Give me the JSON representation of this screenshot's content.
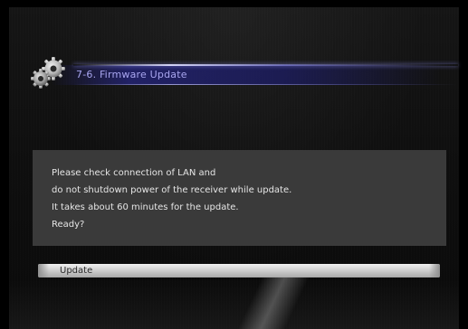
{
  "header": {
    "title": "7-6. Firmware Update",
    "icon": "gears-icon",
    "title_color": "#a9a6f0",
    "bar_color": "#23237a"
  },
  "message": {
    "lines": [
      "Please check connection of LAN and",
      "do not shutdown power of the receiver while update.",
      "It takes about 60 minutes for the update.",
      "Ready?"
    ],
    "box_color": "#3a3a3a"
  },
  "actions": {
    "update_label": "Update"
  }
}
